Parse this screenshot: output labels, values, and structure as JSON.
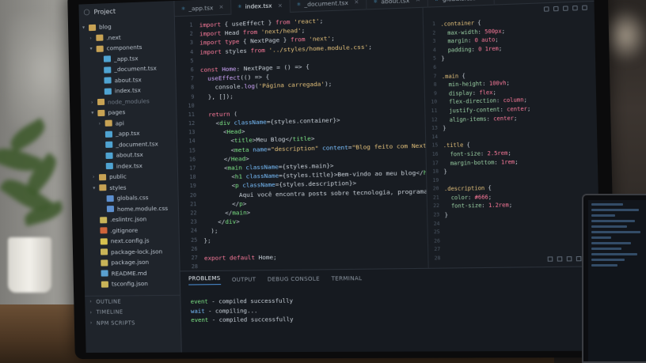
{
  "explorer": {
    "title": "Project",
    "tree": [
      {
        "label": "blog",
        "type": "folder",
        "open": true,
        "depth": 0
      },
      {
        "label": ".next",
        "type": "folder",
        "open": false,
        "depth": 1
      },
      {
        "label": "components",
        "type": "folder",
        "open": true,
        "depth": 1
      },
      {
        "label": "_app.tsx",
        "type": "tsx",
        "depth": 2
      },
      {
        "label": "_document.tsx",
        "type": "tsx",
        "depth": 2
      },
      {
        "label": "about.tsx",
        "type": "tsx",
        "depth": 2
      },
      {
        "label": "index.tsx",
        "type": "tsx",
        "depth": 2
      },
      {
        "label": "node_modules",
        "type": "folder",
        "open": false,
        "depth": 1,
        "dim": true
      },
      {
        "label": "pages",
        "type": "folder",
        "open": true,
        "depth": 1
      },
      {
        "label": "api",
        "type": "folder",
        "open": false,
        "depth": 2
      },
      {
        "label": "_app.tsx",
        "type": "tsx",
        "depth": 2
      },
      {
        "label": "_document.tsx",
        "type": "tsx",
        "depth": 2
      },
      {
        "label": "about.tsx",
        "type": "tsx",
        "depth": 2
      },
      {
        "label": "index.tsx",
        "type": "tsx",
        "depth": 2
      },
      {
        "label": "public",
        "type": "folder",
        "open": false,
        "depth": 1
      },
      {
        "label": "styles",
        "type": "folder",
        "open": true,
        "depth": 1
      },
      {
        "label": "globals.css",
        "type": "css",
        "depth": 2
      },
      {
        "label": "home.module.css",
        "type": "css",
        "depth": 2
      },
      {
        "label": ".eslintrc.json",
        "type": "json",
        "depth": 1
      },
      {
        "label": ".gitignore",
        "type": "git",
        "depth": 1
      },
      {
        "label": "next.config.js",
        "type": "js",
        "depth": 1
      },
      {
        "label": "package-lock.json",
        "type": "json",
        "depth": 1
      },
      {
        "label": "package.json",
        "type": "json",
        "depth": 1
      },
      {
        "label": "README.md",
        "type": "md",
        "depth": 1
      },
      {
        "label": "tsconfig.json",
        "type": "json",
        "depth": 1
      }
    ],
    "sections": [
      "OUTLINE",
      "TIMELINE",
      "NPM SCRIPTS"
    ]
  },
  "tabs": [
    {
      "label": "_app.tsx",
      "active": false
    },
    {
      "label": "index.tsx",
      "active": true
    },
    {
      "label": "_document.tsx",
      "active": false
    },
    {
      "label": "about.tsx",
      "active": false
    },
    {
      "label": "globals.css",
      "active": false
    }
  ],
  "editor": {
    "line_numbers": [
      "1",
      "2",
      "3",
      "4",
      "5",
      "6",
      "7",
      "8",
      "9",
      "10",
      "11",
      "12",
      "13",
      "14",
      "15",
      "16",
      "17",
      "18",
      "19",
      "20",
      "21",
      "22",
      "23",
      "24",
      "25",
      "26",
      "27",
      "28"
    ]
  },
  "css_pane": {
    "line_numbers": [
      "1",
      "2",
      "3",
      "4",
      "5",
      "6",
      "7",
      "8",
      "9",
      "10",
      "11",
      "12",
      "13",
      "14",
      "15",
      "16",
      "17",
      "18",
      "19",
      "20",
      "21",
      "22",
      "23",
      "24",
      "25",
      "26",
      "27",
      "28"
    ]
  },
  "panel": {
    "tabs": [
      "PROBLEMS",
      "OUTPUT",
      "DEBUG CONSOLE",
      "TERMINAL"
    ],
    "terminal": [
      {
        "level": "event",
        "text": " - compiled successfully"
      },
      {
        "level": "wait",
        "text": " - compiling..."
      },
      {
        "level": "event",
        "text": " - compiled successfully"
      }
    ]
  }
}
